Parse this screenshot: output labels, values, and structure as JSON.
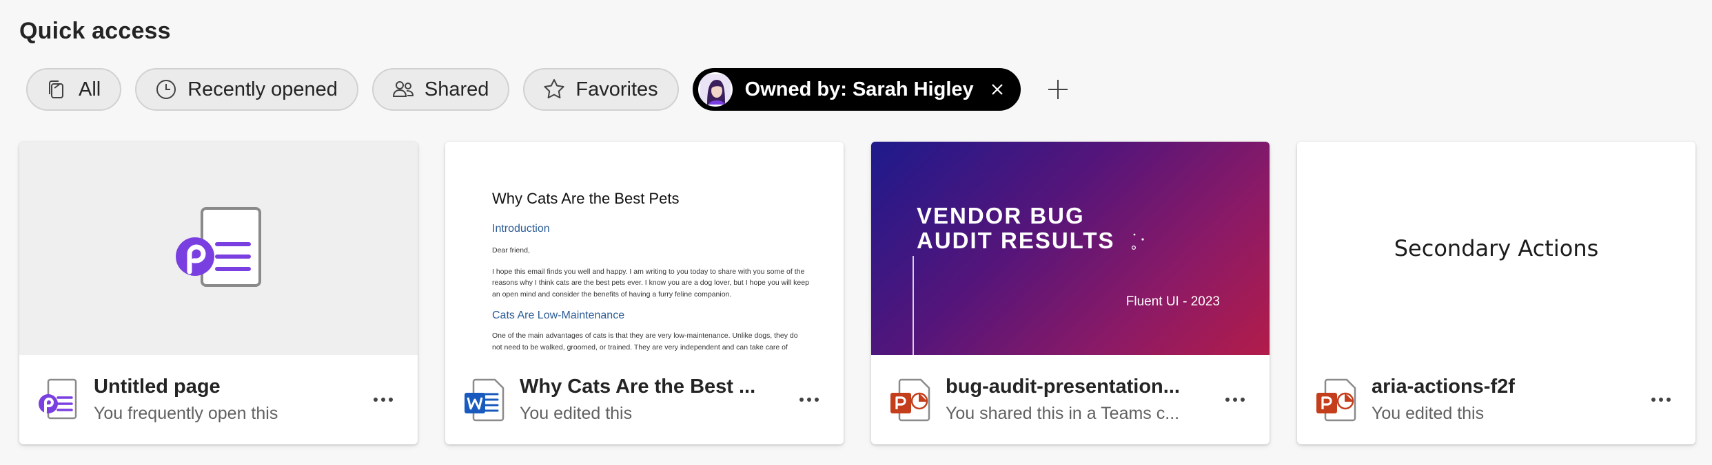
{
  "section": {
    "title": "Quick access"
  },
  "filters": {
    "all": "All",
    "recent": "Recently opened",
    "shared": "Shared",
    "favorites": "Favorites",
    "owner": "Owned by: Sarah Higley"
  },
  "cards": [
    {
      "name": "Untitled page",
      "subtitle": "You frequently open this",
      "icon": "loop-icon"
    },
    {
      "name": "Why Cats Are the Best ...",
      "subtitle": "You edited this",
      "icon": "word-icon",
      "preview": {
        "title": "Why Cats Are the Best Pets",
        "h1": "Introduction",
        "greeting": "Dear friend,",
        "p1": "I hope this email finds you well and happy. I am writing to you today to share with you some of the reasons why I think cats are the best pets ever. I know you are a dog lover, but I hope you will keep an open mind and consider the benefits of having a furry feline companion.",
        "h2": "Cats Are Low-Maintenance",
        "p2": "One of the main advantages of cats is that they are very low-maintenance. Unlike dogs, they do not need to be walked, groomed, or trained. They are very independent and can take care of themselves for the most part. They only need a litter box, some food, water,"
      }
    },
    {
      "name": "bug-audit-presentation...",
      "subtitle": "You shared this in a Teams c...",
      "icon": "powerpoint-icon",
      "preview": {
        "title_line1": "VENDOR BUG",
        "title_line2": "AUDIT RESULTS",
        "subtitle": "Fluent UI - 2023"
      }
    },
    {
      "name": "aria-actions-f2f",
      "subtitle": "You edited this",
      "icon": "powerpoint-icon",
      "preview": {
        "text": "Secondary Actions"
      }
    }
  ],
  "colors": {
    "accent_loop": "#7a3fe0",
    "word": "#185abd",
    "powerpoint": "#c43e1c",
    "owner_pill": "#000000"
  }
}
